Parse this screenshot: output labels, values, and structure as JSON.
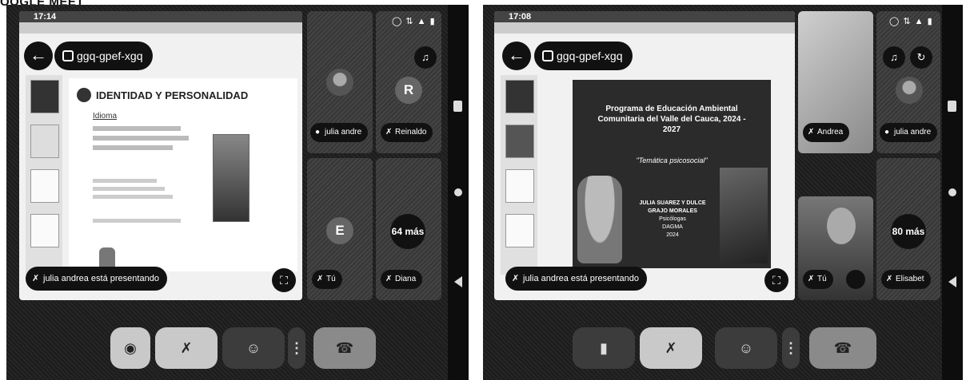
{
  "caption": "OOGLE MEET",
  "left": {
    "status_time": "17:14",
    "meeting_code": "ggq-gpef-xgq",
    "slide_title": "IDENTIDAD Y PERSONALIDAD",
    "slide_subtitle": "Idioma",
    "presenting_text": "julia andrea está presentando",
    "participants": [
      {
        "name": "julia andre",
        "avatar": "photo"
      },
      {
        "name": "Reinaldo",
        "avatar_letter": "R"
      },
      {
        "name": "Tú",
        "avatar_letter": "E"
      },
      {
        "name": "Diana",
        "more_text": "64 más"
      }
    ]
  },
  "right": {
    "status_time": "17:08",
    "meeting_code": "ggq-gpef-xgq",
    "slide_title": "Programa de Educación Ambiental Comunitaria del Valle del Cauca, 2024 - 2027",
    "slide_subtitle": "\"Temática psicosocial\"",
    "slide_names": [
      "JULIA SUAREZ Y DULCE",
      "GRAJO MORALES",
      "Psicólogas",
      "DAGMA",
      "2024"
    ],
    "presenting_text": "julia andrea está presentando",
    "participants": [
      {
        "name": "Andrea"
      },
      {
        "name": "julia andre"
      },
      {
        "name": "Tú"
      },
      {
        "name": "Elisabet",
        "more_text": "80 más"
      }
    ]
  }
}
